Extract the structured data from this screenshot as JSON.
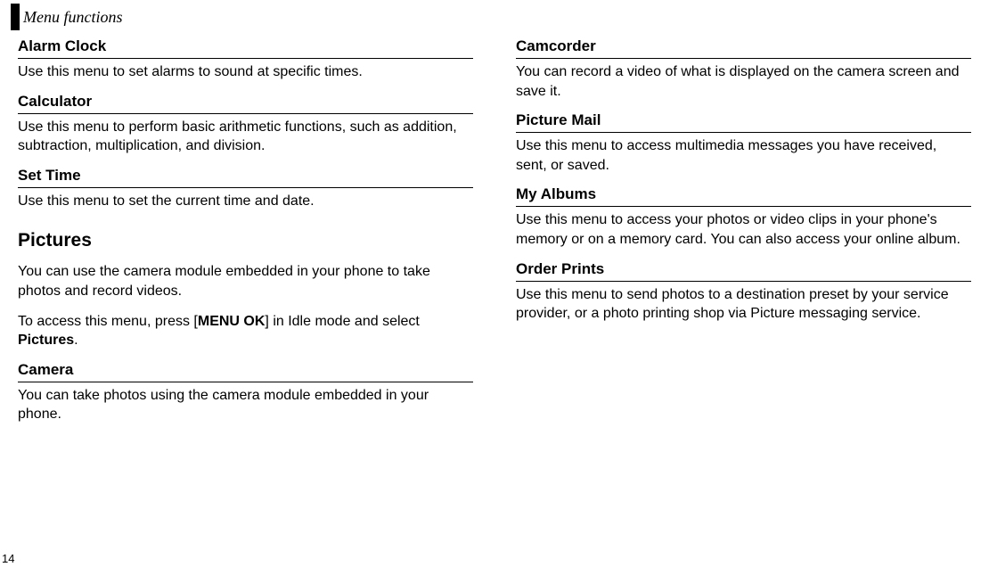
{
  "running_head": "Menu functions",
  "page_number": "14",
  "left": {
    "alarm_h": "Alarm Clock",
    "alarm_b": "Use this menu to set alarms to sound at specific times.",
    "calc_h": "Calculator",
    "calc_b": "Use this menu to perform basic arithmetic functions, such as addition, subtraction, multiplication, and division.",
    "settime_h": "Set Time",
    "settime_b": "Use this menu to set the current time and date.",
    "pictures_h": "Pictures",
    "pictures_b1": "You can use the camera module embedded in your phone to take photos and record videos.",
    "pictures_b2_pre": "To access this menu, press [",
    "pictures_b2_bold": "MENU OK",
    "pictures_b2_mid": "] in Idle mode and select ",
    "pictures_b2_bold2": "Pictures",
    "pictures_b2_end": ".",
    "camera_h": "Camera",
    "camera_b": "You can take photos using the camera module embedded in your phone."
  },
  "right": {
    "camcorder_h": "Camcorder",
    "camcorder_b": "You can record a video of what is displayed on the camera screen and save it.",
    "picmail_h": "Picture Mail",
    "picmail_b": "Use this menu to access multimedia messages you have received, sent, or saved.",
    "albums_h": "My Albums",
    "albums_b": "Use this menu to access your photos or video clips in your phone's memory or on a memory card. You can also access your online album.",
    "prints_h": "Order Prints",
    "prints_b": "Use this menu to send photos to a destination preset by your service provider, or a photo printing shop via Picture messaging service."
  }
}
